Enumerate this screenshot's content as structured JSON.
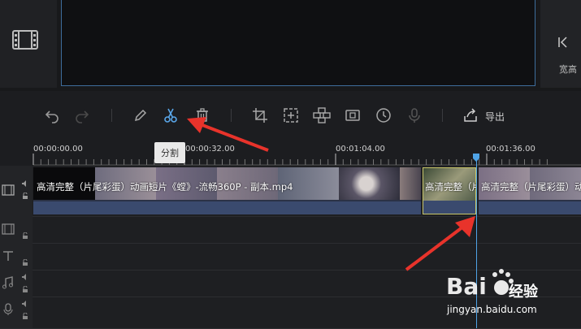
{
  "preview": {
    "aspect_label": "宽高"
  },
  "toolbar": {
    "tools": [
      {
        "name": "undo-icon"
      },
      {
        "name": "redo-icon"
      },
      {
        "name": "edit-icon"
      },
      {
        "name": "split-scissors-icon"
      },
      {
        "name": "delete-icon"
      },
      {
        "name": "crop-icon"
      },
      {
        "name": "zoom-icon"
      },
      {
        "name": "mosaic-icon"
      },
      {
        "name": "freeze-frame-icon"
      },
      {
        "name": "speed-icon"
      },
      {
        "name": "record-mic-icon"
      },
      {
        "name": "export-icon"
      }
    ],
    "export_label": "导出"
  },
  "tooltip": {
    "label": "分割"
  },
  "ruler": {
    "labels": [
      "00:00:00.00",
      "00:00:32.00",
      "00:01:04.00",
      "00:01:36.00"
    ]
  },
  "clips": [
    {
      "title": "高清完整（片尾彩蛋）动画短片《螳》-流畅360P - 副本.mp4"
    },
    {
      "title": "高清完整（片尾彩蛋）动画短片"
    },
    {
      "title": "高清完整（片尾彩蛋）动画短片"
    }
  ],
  "watermark": {
    "brand": "经验",
    "url": "jingyan.baidu.com"
  },
  "colors": {
    "accent": "#4fa3e6",
    "selection": "#c9c66a",
    "arrow": "#e8332b"
  }
}
